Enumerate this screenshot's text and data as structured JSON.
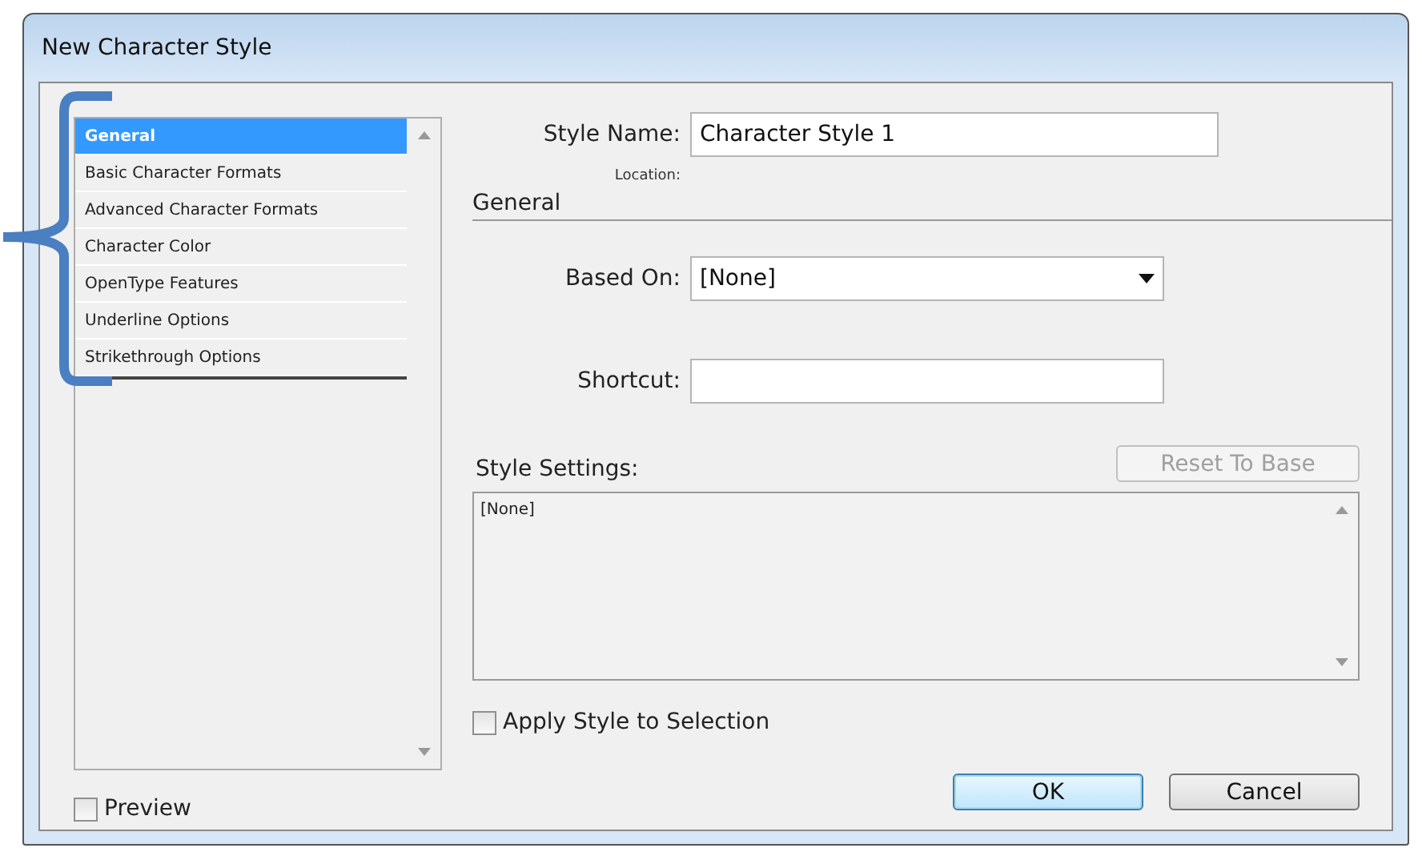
{
  "window": {
    "title": "New Character Style"
  },
  "sidebar": {
    "items": [
      {
        "label": "General",
        "selected": true
      },
      {
        "label": "Basic Character Formats",
        "selected": false
      },
      {
        "label": "Advanced Character Formats",
        "selected": false
      },
      {
        "label": "Character Color",
        "selected": false
      },
      {
        "label": "OpenType Features",
        "selected": false
      },
      {
        "label": "Underline Options",
        "selected": false
      },
      {
        "label": "Strikethrough Options",
        "selected": false
      }
    ]
  },
  "style_name": {
    "label": "Style Name:",
    "value": "Character Style 1"
  },
  "location": {
    "label": "Location:"
  },
  "section": {
    "title": "General"
  },
  "based_on": {
    "label": "Based On:",
    "value": "[None]"
  },
  "shortcut": {
    "label": "Shortcut:"
  },
  "style_settings": {
    "label": "Style Settings:",
    "reset_button": {
      "label": "Reset To Base",
      "disabled": true
    },
    "text": "[None]"
  },
  "apply_style": {
    "label": "Apply Style to Selection",
    "checked": false
  },
  "preview": {
    "label": "Preview",
    "checked": false
  },
  "buttons": [
    {
      "label": "OK",
      "default": true
    },
    {
      "label": "Cancel",
      "default": false
    }
  ]
}
